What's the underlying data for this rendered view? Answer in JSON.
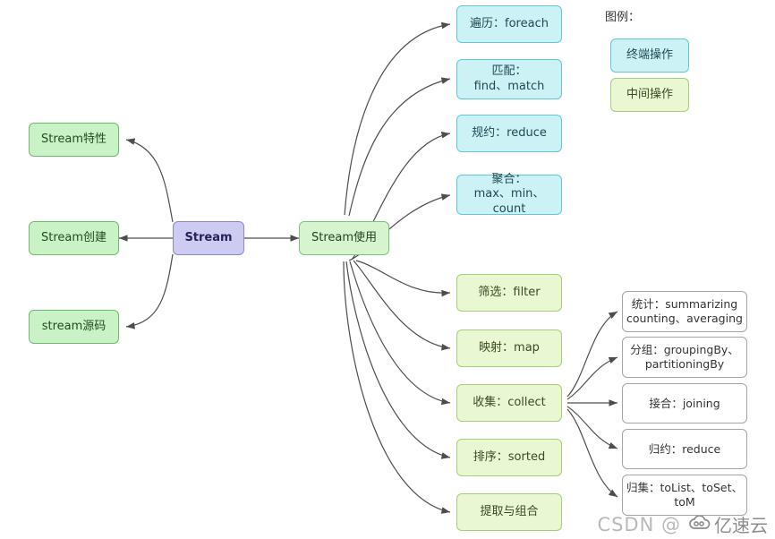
{
  "diagram": {
    "title": "Java Stream 思维导图",
    "background": "#ffffff"
  },
  "colors": {
    "terminal_fill": "#cdf2f5",
    "terminal_stroke": "#63c6d6",
    "intermediate_fill": "#e9f7d2",
    "intermediate_stroke": "#a8cc7a",
    "root_fill": "#cecbf2",
    "root_stroke": "#8b86d6",
    "branch_fill": "#c9f3c6",
    "branch_stroke": "#6bbf6b",
    "sub_fill": "#ffffff",
    "sub_stroke": "#a5a5a5",
    "edge_stroke": "#4d4d4d"
  },
  "root": {
    "label": "Stream"
  },
  "left_branches": [
    {
      "label": "Stream特性"
    },
    {
      "label": "Stream创建"
    },
    {
      "label": "stream源码"
    }
  ],
  "center_branch": {
    "label": "Stream使用"
  },
  "terminal_ops": [
    {
      "label": "遍历：foreach"
    },
    {
      "label": "匹配：\nfind、match"
    },
    {
      "label": "规约：reduce"
    },
    {
      "label": "聚合：\nmax、min、count"
    }
  ],
  "intermediate_ops": [
    {
      "label": "筛选：filter"
    },
    {
      "label": "映射：map"
    },
    {
      "label": "收集：collect"
    },
    {
      "label": "排序：sorted"
    },
    {
      "label": "提取与组合"
    }
  ],
  "collect_children": [
    {
      "label": "统计：summarizing\ncounting、averaging"
    },
    {
      "label": "分组：groupingBy、\npartitioningBy"
    },
    {
      "label": "接合：joining"
    },
    {
      "label": "归约：reduce"
    },
    {
      "label": "归集：toList、toSet、\ntoM"
    }
  ],
  "legend": {
    "title": "图例：",
    "items": [
      {
        "label": "终端操作",
        "kind": "terminal"
      },
      {
        "label": "中间操作",
        "kind": "intermediate"
      }
    ]
  },
  "watermark": {
    "prefix": "CSDN @",
    "brand": "亿速云"
  }
}
